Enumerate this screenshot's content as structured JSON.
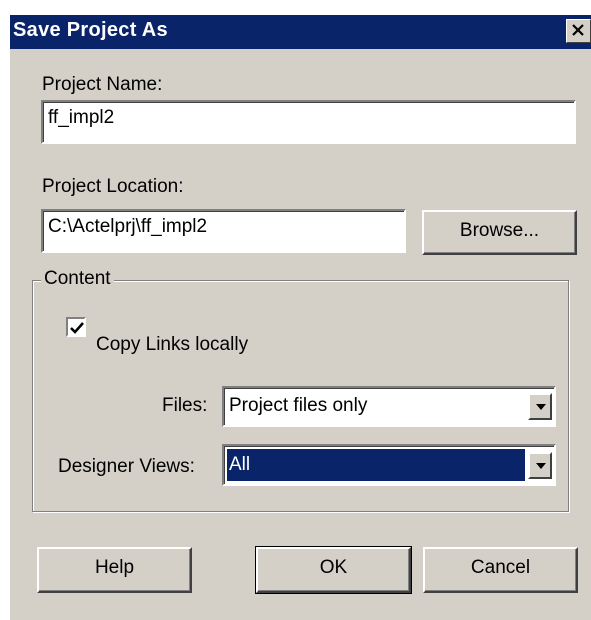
{
  "window": {
    "title": "Save Project As"
  },
  "project_name": {
    "label": "Project Name:",
    "value": "ff_impl2"
  },
  "project_location": {
    "label": "Project Location:",
    "value": "C:\\Actelprj\\ff_impl2",
    "browse_label": "Browse..."
  },
  "content": {
    "legend": "Content",
    "copy_links": {
      "label": "Copy Links locally",
      "checked": true
    },
    "files": {
      "label": "Files:",
      "selected": "Project files only"
    },
    "designer_views": {
      "label": "Designer Views:",
      "selected": "All"
    }
  },
  "buttons": {
    "help": "Help",
    "ok": "OK",
    "cancel": "Cancel"
  },
  "colors": {
    "title_bar": "#0a246a",
    "face": "#d4d0c8",
    "selection": "#0a246a"
  }
}
